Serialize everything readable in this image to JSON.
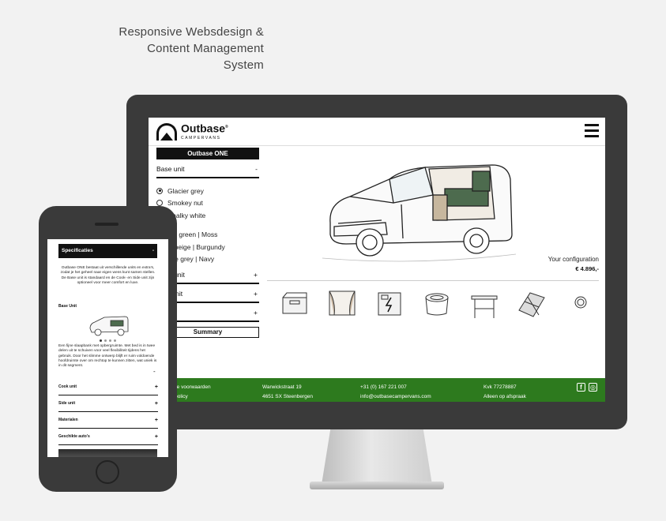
{
  "headline": [
    "Responsive Websdesign &",
    "Content Management",
    "System"
  ],
  "desktop": {
    "logo": {
      "name": "Outbase",
      "sub": "CAMPERVANS",
      "registered": "®"
    },
    "sidebar": {
      "title": "Outbase ONE",
      "base_unit": {
        "label": "Base unit",
        "toggle": "-"
      },
      "radios": [
        {
          "label": "Glacier grey",
          "selected": true
        },
        {
          "label": "Smokey nut",
          "selected": false
        },
        {
          "label": "Chalky white",
          "selected": false
        }
      ],
      "fabrics": [
        "Leaf of green | Moss",
        "Earth beige | Burgundy",
        "Granite grey | Navy"
      ],
      "collapsed_sections": [
        {
          "label": "Cook unit",
          "toggle": "+"
        },
        {
          "label": "Side unit",
          "toggle": "+"
        },
        {
          "label": "",
          "toggle": "+"
        }
      ],
      "summary_label": "Summary"
    },
    "config": {
      "label": "Your configuration",
      "price": "€ 4.896,-"
    },
    "thumbnails": [
      "cooler-box-icon",
      "curtains-icon",
      "power-station-icon",
      "toilet-icon",
      "folding-table-icon",
      "solar-panel-icon",
      "led-light-icon"
    ],
    "footer": {
      "col1": [
        "Algemene voorwaarden",
        "Privacy policy"
      ],
      "col2": [
        "Warwickstraat 19",
        "4651 SX Steenbergen"
      ],
      "col3": [
        "+31 (0) 167 221 007",
        "info@outbasecampervans.com"
      ],
      "col4": [
        "Kvk 77278887",
        "Alleen op afspraak"
      ],
      "color": "#2d7a1e"
    }
  },
  "mobile": {
    "header": {
      "title": "Specificaties",
      "toggle": "-"
    },
    "intro": "Outbase ONE bestaat uit verschillende units en extra's, zodat je het geheel naar eigen wens kunt samen stellen. De Base unit is standaard en de Cook- en Side unit zijn optioneel voor meer comfort en luxe.",
    "base_title": "Base Unit",
    "desc": "Een fijne slaapbank met opbergruimte. Met bed is in twee delen uit te schuiven voor veel flexibiliteit tijdens het gebruik. Door het slimme ontwerp blijft er ruim voldoende hoofdruimte over om rechtop te kunnen zitten, wat uniek is in dit segment.",
    "minus": "-",
    "sections": [
      {
        "label": "Cook unit",
        "toggle": "+"
      },
      {
        "label": "Side unit",
        "toggle": "+"
      },
      {
        "label": "Materialen",
        "toggle": "+"
      },
      {
        "label": "Geschikte auto's",
        "toggle": "+"
      }
    ]
  }
}
